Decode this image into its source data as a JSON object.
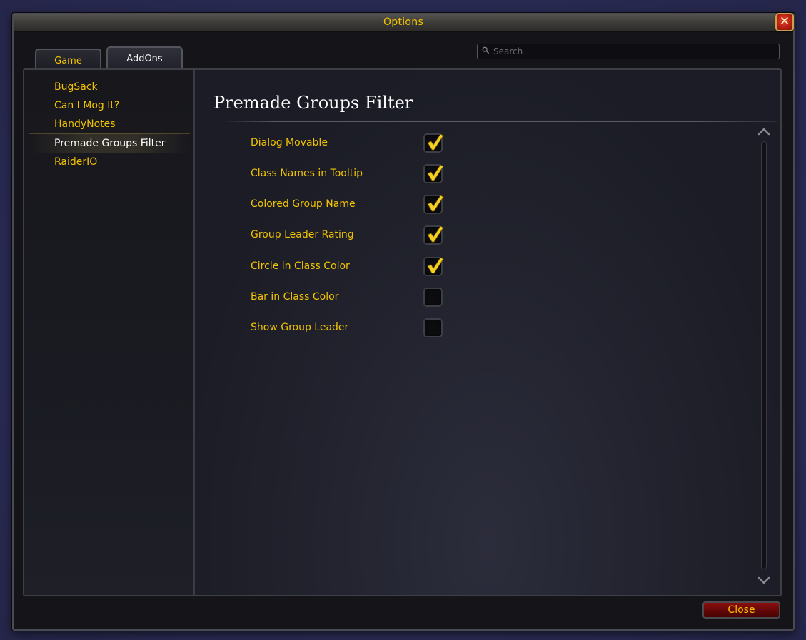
{
  "window": {
    "title": "Options"
  },
  "tabs": [
    {
      "label": "Game",
      "active": false
    },
    {
      "label": "AddOns",
      "active": true
    }
  ],
  "search": {
    "placeholder": "Search",
    "value": ""
  },
  "sidebar": {
    "items": [
      {
        "label": "BugSack",
        "selected": false
      },
      {
        "label": "Can I Mog It?",
        "selected": false
      },
      {
        "label": "HandyNotes",
        "selected": false
      },
      {
        "label": "Premade Groups Filter",
        "selected": true
      },
      {
        "label": "RaiderIO",
        "selected": false
      }
    ]
  },
  "main": {
    "heading": "Premade Groups Filter",
    "options": [
      {
        "label": "Dialog Movable",
        "checked": true
      },
      {
        "label": "Class Names in Tooltip",
        "checked": true
      },
      {
        "label": "Colored Group Name",
        "checked": true
      },
      {
        "label": "Group Leader Rating",
        "checked": true
      },
      {
        "label": "Circle in Class Color",
        "checked": true
      },
      {
        "label": "Bar in Class Color",
        "checked": false
      },
      {
        "label": "Show Group Leader",
        "checked": false
      }
    ]
  },
  "footer": {
    "close_label": "Close"
  },
  "colors": {
    "accent_gold": "#f2c400",
    "check_gold": "#f5d020",
    "close_red": "#8d0f0f"
  },
  "icons": {
    "window_close": "close-x-icon",
    "search": "search-icon",
    "check": "checkmark-icon",
    "scroll_up": "chevron-up-icon",
    "scroll_down": "chevron-down-icon"
  }
}
